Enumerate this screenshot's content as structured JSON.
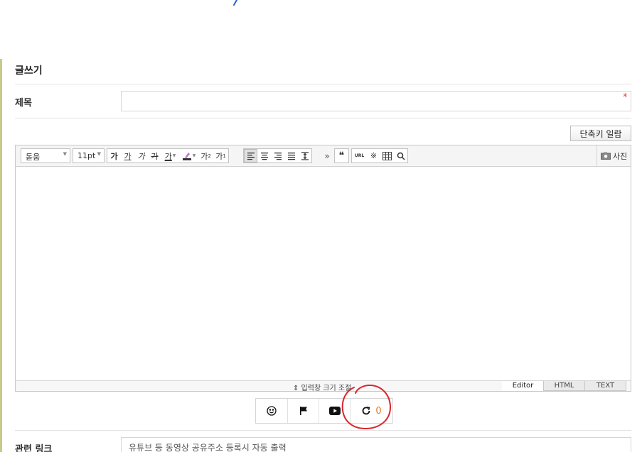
{
  "form": {
    "heading": "글쓰기",
    "subject_label": "제목",
    "subject_value": "",
    "required_mark": "*",
    "shortcut_button": "단축키 일람",
    "link_label": "관련 링크",
    "link_placeholder": "유튜브 등 동영상 공유주소 등록시 자동 출력"
  },
  "editor": {
    "font_family": "돋움",
    "font_size": "11pt",
    "format_buttons": [
      {
        "name": "bold",
        "label": "가"
      },
      {
        "name": "underline",
        "label": "가"
      },
      {
        "name": "italic",
        "label": "가"
      },
      {
        "name": "strikethrough",
        "label": "가"
      },
      {
        "name": "font-color",
        "label": "가"
      }
    ],
    "superscript_label": "가",
    "subscript_label": "가",
    "photo_label": "사진",
    "url_label": "URL",
    "resize_label": "⇕ 입력창 크기 조절",
    "modes": [
      "Editor",
      "HTML",
      "TEXT"
    ],
    "active_mode": "Editor"
  },
  "actions": {
    "refresh_count": "0"
  },
  "colors": {
    "required": "#e1413c",
    "count": "#e07b1f",
    "annotation": "#d8262c"
  }
}
